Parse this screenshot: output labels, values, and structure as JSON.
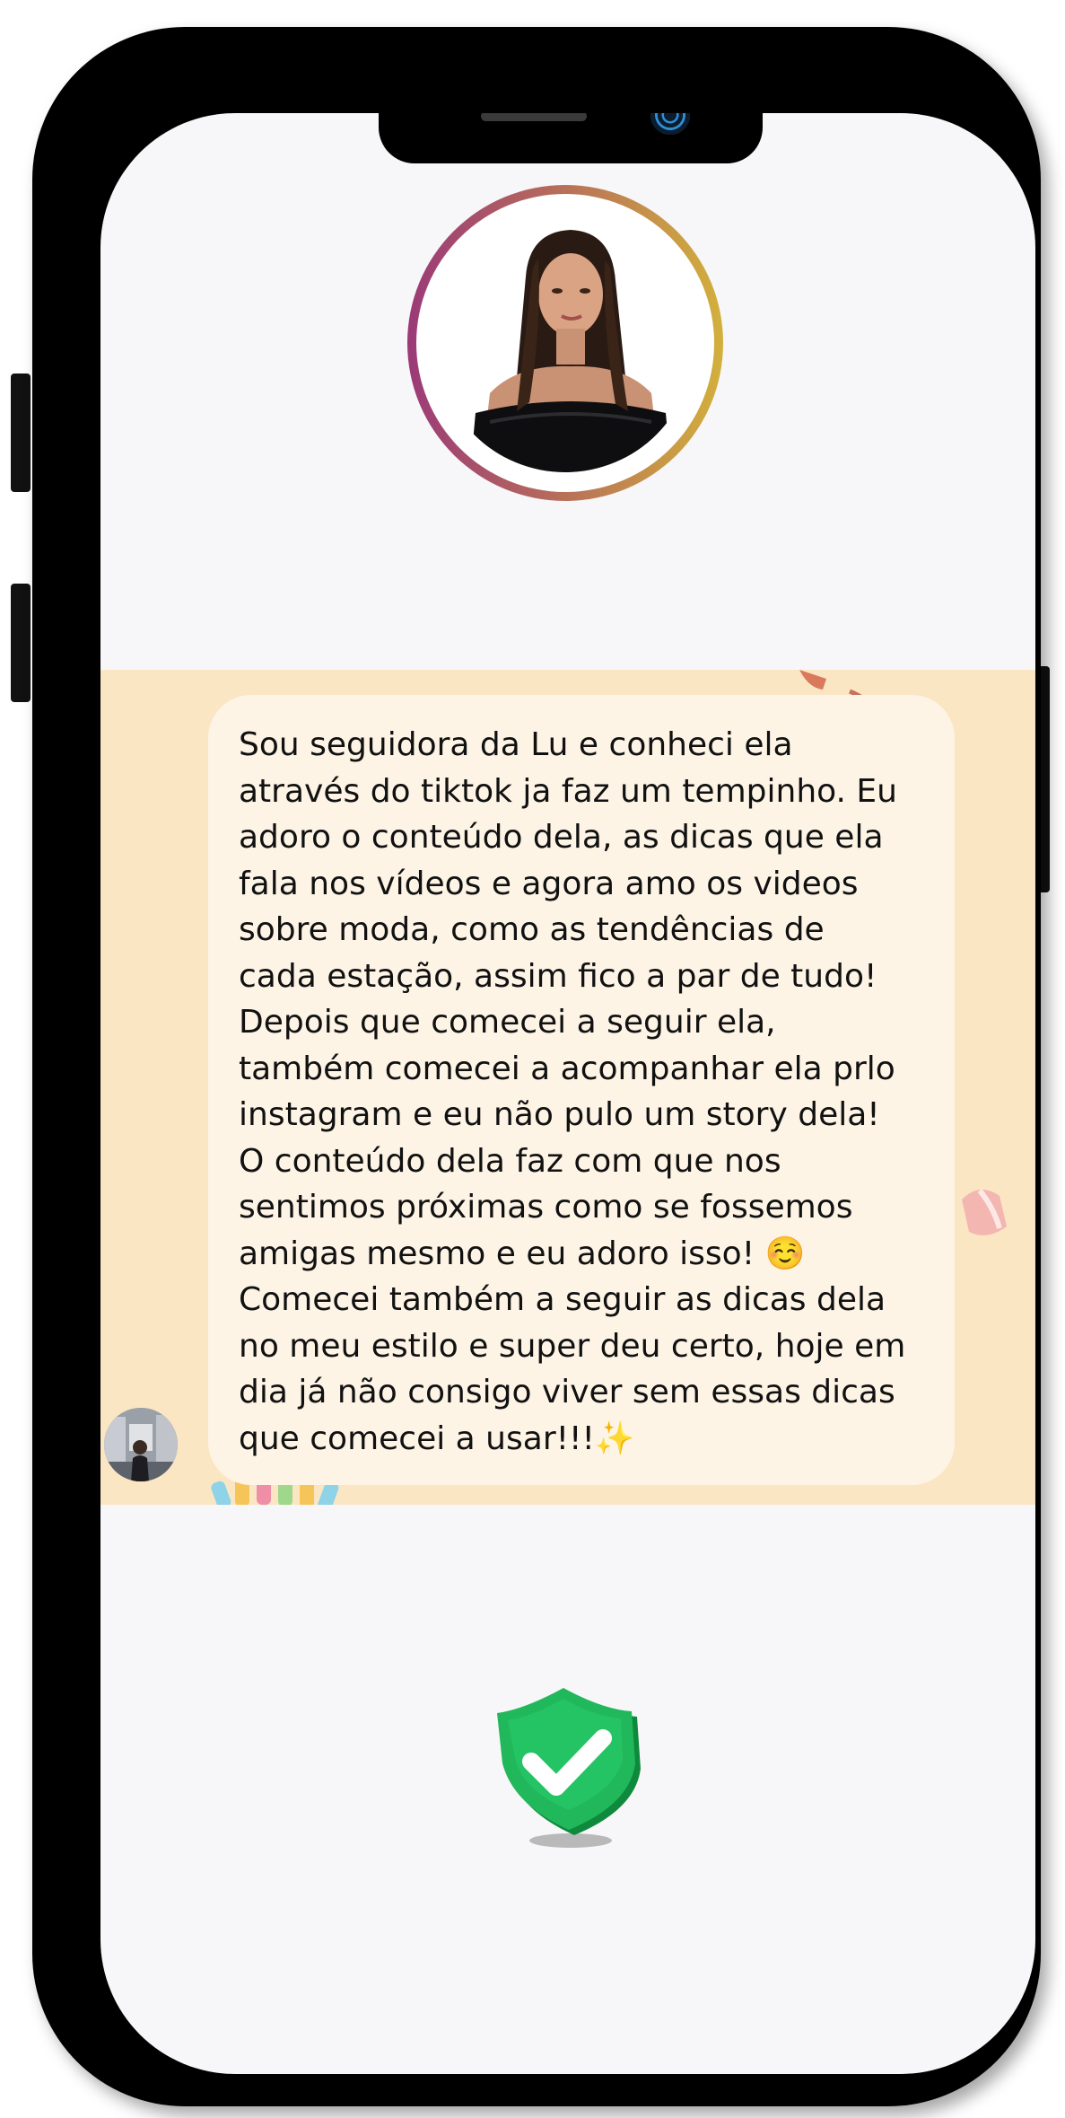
{
  "device": {
    "frame_color": "#000000",
    "screen_background": "#f7f7f9"
  },
  "profile": {
    "avatar_icon": "profile-photo",
    "ring_colors": [
      "#9b3a78",
      "#b56a5c",
      "#d2b03c"
    ]
  },
  "chat": {
    "background_color": "#fbe6c4",
    "bubble_color": "#fdf4e6",
    "sender_avatar_icon": "sender-avatar",
    "message_lines": [
      "Sou seguidora da Lu e conheci ela",
      "através do tiktok ja faz um tempinho. Eu",
      "adoro o conteúdo dela, as dicas que ela",
      "fala nos vídeos e agora amo os videos",
      "sobre moda, como as tendências de",
      "cada estação, assim fico a par de tudo!",
      "Depois que comecei a seguir ela,",
      "também comecei a acompanhar ela prlo",
      "instagram e eu não pulo um story dela!",
      "O conteúdo dela faz com que nos",
      "sentimos próximas como se fossemos",
      "amigas mesmo e eu adoro isso! ☺️",
      "Comecei também a seguir as dicas dela",
      "no meu estilo e super deu certo, hoje em",
      "dia já não consigo viver sem essas dicas",
      "que comecei a usar!!!✨"
    ]
  },
  "badge": {
    "icon": "verified-shield-check-icon",
    "color": "#1fb25a"
  }
}
